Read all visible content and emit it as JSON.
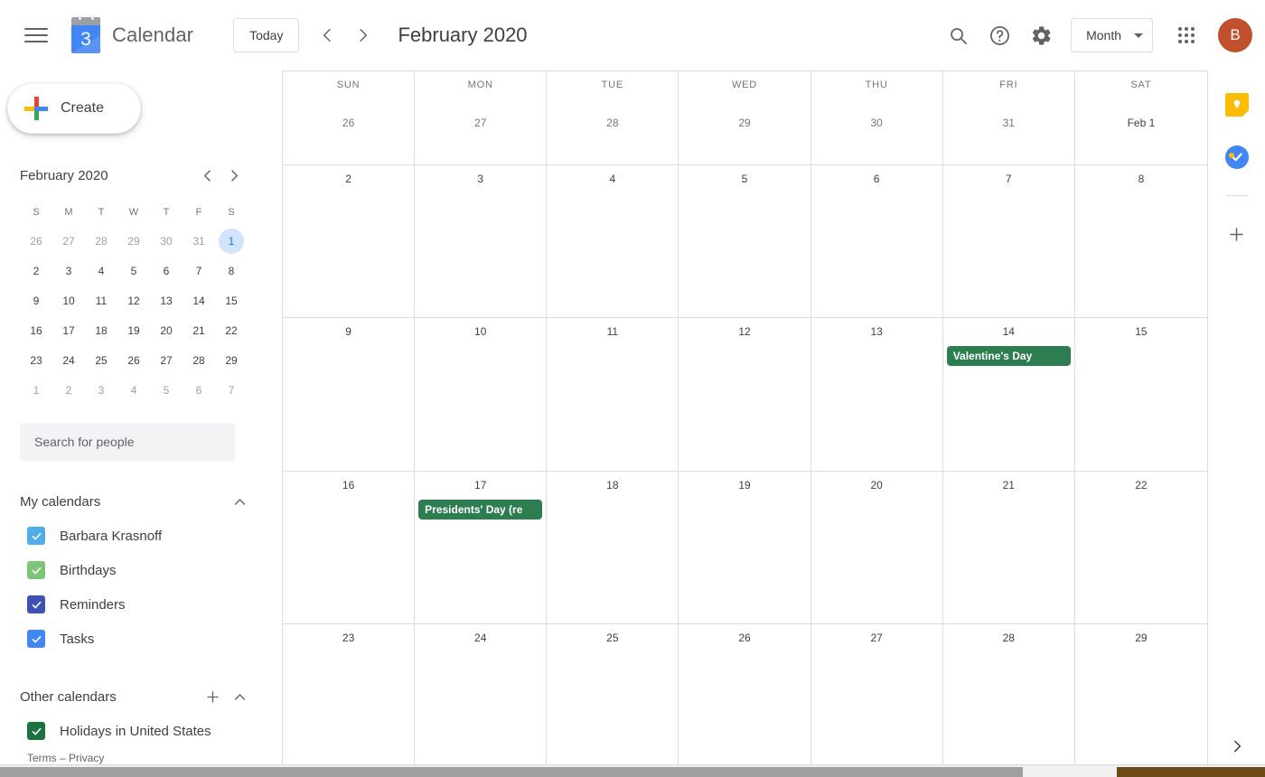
{
  "app": {
    "brand": "Calendar",
    "logo_day": "3",
    "menu_icon": "hamburger-menu-icon"
  },
  "header": {
    "today_label": "Today",
    "prev_icon": "chevron-left-icon",
    "next_icon": "chevron-right-icon",
    "title": "February 2020",
    "search_icon": "search-icon",
    "help_icon": "help-icon",
    "settings_icon": "gear-icon",
    "view_selected": "Month",
    "view_caret_icon": "chevron-down-icon",
    "apps_icon": "apps-grid-icon",
    "avatar_initial": "B"
  },
  "sidebar": {
    "create_label": "Create",
    "create_icon": "plus-icon",
    "mini_calendar": {
      "title": "February 2020",
      "prev_icon": "chevron-left-icon",
      "next_icon": "chevron-right-icon",
      "dow": [
        "S",
        "M",
        "T",
        "W",
        "T",
        "F",
        "S"
      ],
      "weeks": [
        [
          {
            "d": "26",
            "m": true
          },
          {
            "d": "27",
            "m": true
          },
          {
            "d": "28",
            "m": true
          },
          {
            "d": "29",
            "m": true
          },
          {
            "d": "30",
            "m": true
          },
          {
            "d": "31",
            "m": true
          },
          {
            "d": "1",
            "m": false,
            "sel": true
          }
        ],
        [
          {
            "d": "2"
          },
          {
            "d": "3"
          },
          {
            "d": "4"
          },
          {
            "d": "5"
          },
          {
            "d": "6"
          },
          {
            "d": "7"
          },
          {
            "d": "8"
          }
        ],
        [
          {
            "d": "9"
          },
          {
            "d": "10"
          },
          {
            "d": "11"
          },
          {
            "d": "12"
          },
          {
            "d": "13"
          },
          {
            "d": "14"
          },
          {
            "d": "15"
          }
        ],
        [
          {
            "d": "16"
          },
          {
            "d": "17"
          },
          {
            "d": "18"
          },
          {
            "d": "19"
          },
          {
            "d": "20"
          },
          {
            "d": "21"
          },
          {
            "d": "22"
          }
        ],
        [
          {
            "d": "23"
          },
          {
            "d": "24"
          },
          {
            "d": "25"
          },
          {
            "d": "26"
          },
          {
            "d": "27"
          },
          {
            "d": "28"
          },
          {
            "d": "29"
          }
        ],
        [
          {
            "d": "1",
            "m": true
          },
          {
            "d": "2",
            "m": true
          },
          {
            "d": "3",
            "m": true
          },
          {
            "d": "4",
            "m": true
          },
          {
            "d": "5",
            "m": true
          },
          {
            "d": "6",
            "m": true
          },
          {
            "d": "7",
            "m": true
          }
        ]
      ]
    },
    "search_people_placeholder": "Search for people",
    "my_calendars": {
      "title": "My calendars",
      "collapse_icon": "chevron-up-icon",
      "items": [
        {
          "label": "Barbara Krasnoff",
          "color": "#4fade8",
          "checked": true
        },
        {
          "label": "Birthdays",
          "color": "#7cc576",
          "checked": true
        },
        {
          "label": "Reminders",
          "color": "#3f51b5",
          "checked": true
        },
        {
          "label": "Tasks",
          "color": "#4285f4",
          "checked": true
        }
      ]
    },
    "other_calendars": {
      "title": "Other calendars",
      "add_icon": "plus-icon",
      "collapse_icon": "chevron-up-icon",
      "items": [
        {
          "label": "Holidays in United States",
          "color": "#1b7340",
          "checked": true
        }
      ]
    },
    "footer": {
      "terms": "Terms",
      "separator": "–",
      "privacy": "Privacy"
    }
  },
  "calendar_grid": {
    "dow_labels": [
      "SUN",
      "MON",
      "TUE",
      "WED",
      "THU",
      "FRI",
      "SAT"
    ],
    "weeks": [
      [
        {
          "num": "26",
          "muted": true
        },
        {
          "num": "27",
          "muted": true
        },
        {
          "num": "28",
          "muted": true
        },
        {
          "num": "29",
          "muted": true
        },
        {
          "num": "30",
          "muted": true
        },
        {
          "num": "31",
          "muted": true
        },
        {
          "num": "Feb 1",
          "first": true
        }
      ],
      [
        {
          "num": "2"
        },
        {
          "num": "3"
        },
        {
          "num": "4"
        },
        {
          "num": "5"
        },
        {
          "num": "6"
        },
        {
          "num": "7"
        },
        {
          "num": "8"
        }
      ],
      [
        {
          "num": "9"
        },
        {
          "num": "10"
        },
        {
          "num": "11"
        },
        {
          "num": "12"
        },
        {
          "num": "13"
        },
        {
          "num": "14",
          "event": {
            "title": "Valentine's Day",
            "color": "#2c7d4f"
          }
        },
        {
          "num": "15"
        }
      ],
      [
        {
          "num": "16"
        },
        {
          "num": "17",
          "event": {
            "title": "Presidents' Day (re",
            "color": "#2c7d4f"
          }
        },
        {
          "num": "18"
        },
        {
          "num": "19"
        },
        {
          "num": "20"
        },
        {
          "num": "21"
        },
        {
          "num": "22"
        }
      ],
      [
        {
          "num": "23"
        },
        {
          "num": "24"
        },
        {
          "num": "25"
        },
        {
          "num": "26"
        },
        {
          "num": "27"
        },
        {
          "num": "28"
        },
        {
          "num": "29"
        }
      ]
    ]
  },
  "right_rail": {
    "items": [
      {
        "name": "keep-icon",
        "label": "Keep"
      },
      {
        "name": "tasks-icon",
        "label": "Tasks"
      }
    ],
    "add_icon": "plus-icon",
    "expand_icon": "chevron-right-icon"
  }
}
